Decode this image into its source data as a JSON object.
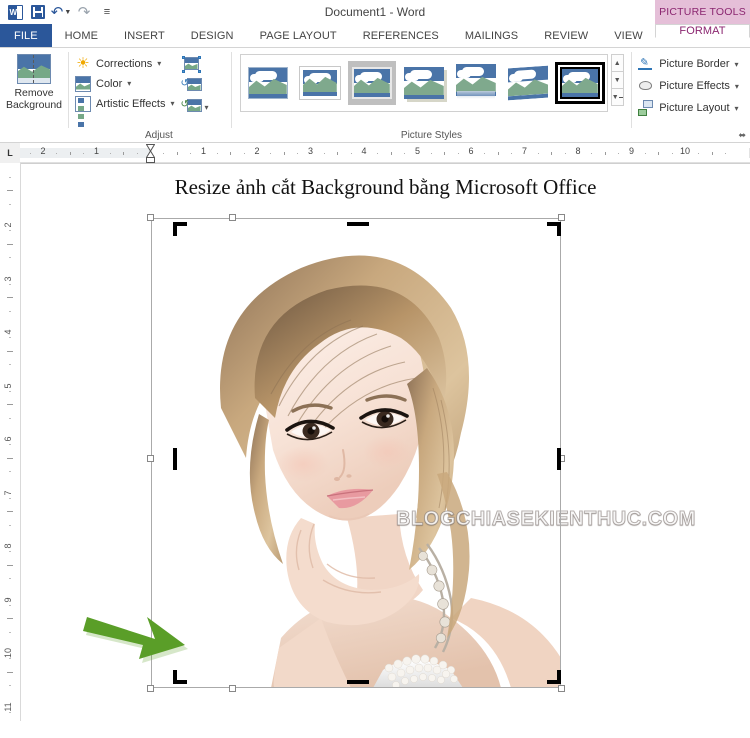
{
  "titlebar": {
    "document_title": "Document1 - Word",
    "contextual_tab_group": "PICTURE TOOLS",
    "qat": [
      {
        "name": "word-logo-icon",
        "label": "W"
      },
      {
        "name": "save-icon",
        "label": "Save"
      },
      {
        "name": "undo-icon",
        "label": "Undo"
      },
      {
        "name": "redo-icon",
        "label": "Redo"
      },
      {
        "name": "customize-qat-icon",
        "label": "Customize Quick Access Toolbar"
      }
    ]
  },
  "ribbon": {
    "tabs": [
      {
        "label": "FILE",
        "active": false
      },
      {
        "label": "HOME",
        "active": false
      },
      {
        "label": "INSERT",
        "active": false
      },
      {
        "label": "DESIGN",
        "active": false
      },
      {
        "label": "PAGE LAYOUT",
        "active": false
      },
      {
        "label": "REFERENCES",
        "active": false
      },
      {
        "label": "MAILINGS",
        "active": false
      },
      {
        "label": "REVIEW",
        "active": false
      },
      {
        "label": "VIEW",
        "active": false
      }
    ],
    "format_tab": "FORMAT",
    "groups": {
      "remove_background": {
        "label_line1": "Remove",
        "label_line2": "Background"
      },
      "adjust": {
        "label": "Adjust",
        "items": [
          {
            "label": "Corrections",
            "icon": "brightness-sun-icon",
            "has_caret": true
          },
          {
            "label": "Color",
            "icon": "color-picture-icon",
            "has_caret": true
          },
          {
            "label": "Artistic Effects",
            "icon": "artistic-effects-icon",
            "has_caret": true
          }
        ],
        "small_icons": [
          {
            "name": "compress-pictures-icon"
          },
          {
            "name": "change-picture-icon"
          },
          {
            "name": "reset-picture-icon",
            "has_caret": true
          }
        ]
      },
      "picture_styles": {
        "label": "Picture Styles",
        "thumbnails": [
          {
            "name": "style-simple-frame",
            "selected": false
          },
          {
            "name": "style-beveled-matte-white",
            "selected": false
          },
          {
            "name": "style-metal-frame",
            "selected": false
          },
          {
            "name": "style-drop-shadow-rectangle",
            "selected": false
          },
          {
            "name": "style-reflected-rounded-rectangle",
            "selected": false
          },
          {
            "name": "style-soft-edge-oval",
            "selected": false
          },
          {
            "name": "style-double-frame-black",
            "selected": true
          }
        ],
        "scroll_buttons": [
          {
            "name": "gallery-scroll-up",
            "glyph": "▲"
          },
          {
            "name": "gallery-scroll-down",
            "glyph": "▼"
          },
          {
            "name": "gallery-more",
            "glyph": "▼"
          }
        ]
      },
      "picture_actions": {
        "items": [
          {
            "label": "Picture Border",
            "icon": "picture-border-icon",
            "has_caret": true
          },
          {
            "label": "Picture Effects",
            "icon": "picture-effects-icon",
            "has_caret": true
          },
          {
            "label": "Picture Layout",
            "icon": "picture-layout-icon",
            "has_caret": true
          }
        ],
        "dialog_launcher": "⬌"
      }
    }
  },
  "ruler": {
    "tab_stop_label": "L",
    "horizontal_left_numbers": [
      "2",
      "1"
    ],
    "horizontal_numbers": [
      "1",
      "2",
      "3",
      "4",
      "5",
      "6",
      "7",
      "8",
      "9",
      "10"
    ],
    "vertical_numbers": [
      "2",
      "3",
      "4",
      "5",
      "6",
      "7",
      "8",
      "9",
      "10",
      "11"
    ]
  },
  "document": {
    "heading": "Resize ảnh cắt Background bằng Microsoft Office",
    "image": {
      "name": "selected-picture",
      "watermark": "BLOGCHIASEKIENTHUC.COM",
      "selected": true,
      "crop_mode": true
    },
    "annotation": {
      "name": "green-arrow-annotation",
      "color": "#5a9e28",
      "points_to": "left-middle-crop-handle"
    }
  },
  "colors": {
    "word_blue": "#2B579A",
    "picture_tools_pink": "#E5BFD8",
    "picture_tools_text": "#8B2670",
    "arrow_green": "#5a9e28"
  }
}
